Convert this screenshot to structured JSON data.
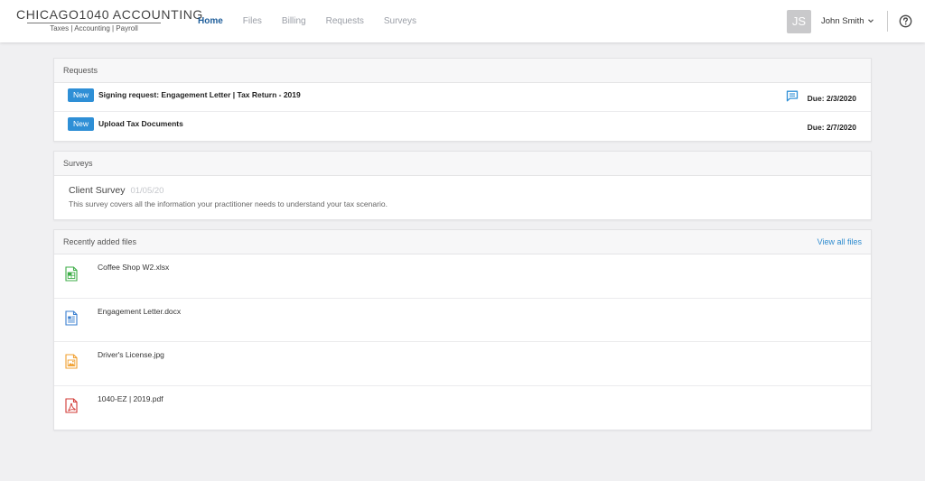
{
  "header": {
    "logo_title": "CHICAGO1040 ACCOUNTING",
    "logo_subtitle": "Taxes | Accounting | Payroll",
    "nav": [
      {
        "label": "Home",
        "active": true
      },
      {
        "label": "Files",
        "active": false
      },
      {
        "label": "Billing",
        "active": false
      },
      {
        "label": "Requests",
        "active": false
      },
      {
        "label": "Surveys",
        "active": false
      }
    ],
    "avatar_initials": "JS",
    "user_name": "John Smith"
  },
  "requests": {
    "header": "Requests",
    "items": [
      {
        "badge": "New",
        "title": "Signing request: Engagement Letter | Tax Return - 2019",
        "due": "Due: 2/3/2020",
        "has_message": true
      },
      {
        "badge": "New",
        "title": "Upload Tax Documents",
        "due": "Due: 2/7/2020",
        "has_message": false
      }
    ]
  },
  "surveys": {
    "header": "Surveys",
    "items": [
      {
        "title": "Client Survey",
        "date": "01/05/20",
        "description": "This survey covers all the information your practitioner needs to understand your tax scenario."
      }
    ]
  },
  "files": {
    "header": "Recently added files",
    "view_all": "View all files",
    "items": [
      {
        "name": "Coffee Shop W2.xlsx",
        "icon": "excel-file-icon",
        "color": "#3fae49"
      },
      {
        "name": "Engagement Letter.docx",
        "icon": "word-file-icon",
        "color": "#3a7fd0"
      },
      {
        "name": "Driver's License.jpg",
        "icon": "image-file-icon",
        "color": "#f0a030"
      },
      {
        "name": "1040-EZ | 2019.pdf",
        "icon": "pdf-file-icon",
        "color": "#d23a35"
      }
    ]
  },
  "colors": {
    "accent": "#2e8fd6",
    "nav_active": "#1f5e9b",
    "link": "#2f8ccf"
  }
}
